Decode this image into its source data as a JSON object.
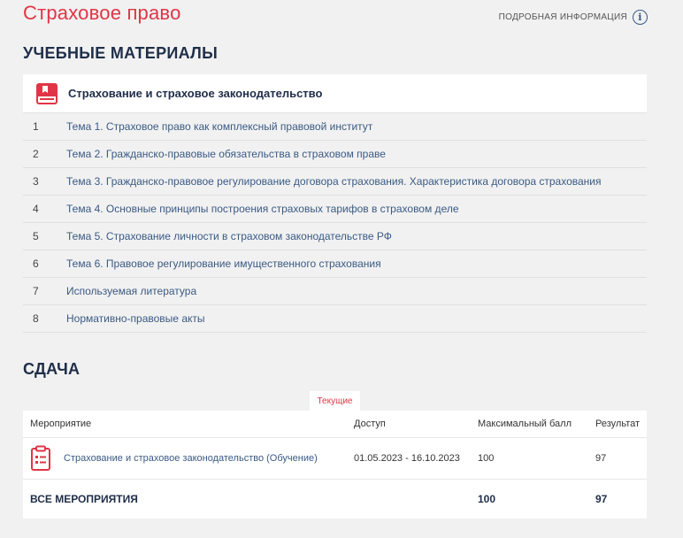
{
  "page": {
    "title": "Страховое право",
    "info_link": "ПОДРОБНАЯ ИНФОРМАЦИЯ"
  },
  "materials": {
    "section_title": "УЧЕБНЫЕ МАТЕРИАЛЫ",
    "course_title": "Страхование и страховое законодательство",
    "items": [
      {
        "num": "1",
        "label": "Тема 1. Страховое право как комплексный правовой институт"
      },
      {
        "num": "2",
        "label": "Тема 2. Гражданско-правовые обязательства в страховом праве"
      },
      {
        "num": "3",
        "label": "Тема 3. Гражданско-правовое регулирование договора страхования. Характеристика договора страхования"
      },
      {
        "num": "4",
        "label": "Тема 4. Основные принципы построения страховых тарифов в страховом деле"
      },
      {
        "num": "5",
        "label": "Тема 5. Страхование личности в страховом законодательстве РФ"
      },
      {
        "num": "6",
        "label": "Тема 6. Правовое регулирование имущественного страхования"
      },
      {
        "num": "7",
        "label": "Используемая литература"
      },
      {
        "num": "8",
        "label": "Нормативно-правовые акты"
      }
    ]
  },
  "exam": {
    "section_title": "СДАЧА",
    "tab_current": "Текущие",
    "columns": {
      "event": "Мероприятие",
      "access": "Доступ",
      "max_score": "Максимальный балл",
      "result": "Результат"
    },
    "rows": [
      {
        "event": "Страхование и страховое законодательство (Обучение)",
        "access": "01.05.2023 - 16.10.2023",
        "max_score": "100",
        "result": "97"
      }
    ],
    "total": {
      "label": "ВСЕ МЕРОПРИЯТИЯ",
      "max_score": "100",
      "result": "97"
    }
  },
  "colors": {
    "accent_red": "#e03546",
    "heading_navy": "#1f2e49",
    "link_blue": "#3a5a84",
    "background": "#f1f1f1"
  },
  "icons": {
    "info": "info-circle-icon",
    "book": "book-icon",
    "clipboard": "clipboard-list-icon"
  }
}
